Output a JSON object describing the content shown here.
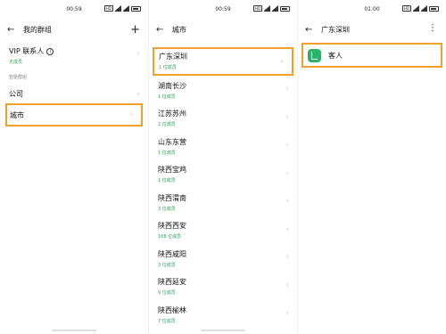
{
  "screen1": {
    "time": "00:59",
    "title": "我的群组",
    "vip": {
      "label": "VIP 联系人",
      "info_glyph": "i",
      "sub": "无成员"
    },
    "section_label": "智能群组",
    "rows": [
      {
        "label": "公司"
      },
      {
        "label": "城市"
      }
    ]
  },
  "screen2": {
    "time": "00:59",
    "title": "城市",
    "cities": [
      {
        "name": "广东深圳",
        "count": "1 位成员"
      },
      {
        "name": "湖南长沙",
        "count": "1 位成员"
      },
      {
        "name": "江苏苏州",
        "count": "2 位成员"
      },
      {
        "name": "山东东营",
        "count": "1 位成员"
      },
      {
        "name": "陕西宝鸡",
        "count": "1 位成员"
      },
      {
        "name": "陕西渭南",
        "count": "3 位成员"
      },
      {
        "name": "陕西西安",
        "count": "168 位成员"
      },
      {
        "name": "陕西咸阳",
        "count": "3 位成员"
      },
      {
        "name": "陕西延安",
        "count": "9 位成员"
      },
      {
        "name": "陕西榆林",
        "count": "7 位成员"
      }
    ]
  },
  "screen3": {
    "time": "01:00",
    "title": "广东深圳",
    "contact": {
      "name": "客人"
    }
  },
  "status": {
    "box_label": "HD"
  },
  "icons": {
    "back": "arrow-left-icon",
    "add": "plus-icon",
    "more": "kebab-menu-icon",
    "chevron": "chevron-right-icon"
  },
  "colors": {
    "highlight": "#f0a02a",
    "accent_green": "#2e9c5a",
    "avatar_green": "#2bb36a"
  }
}
